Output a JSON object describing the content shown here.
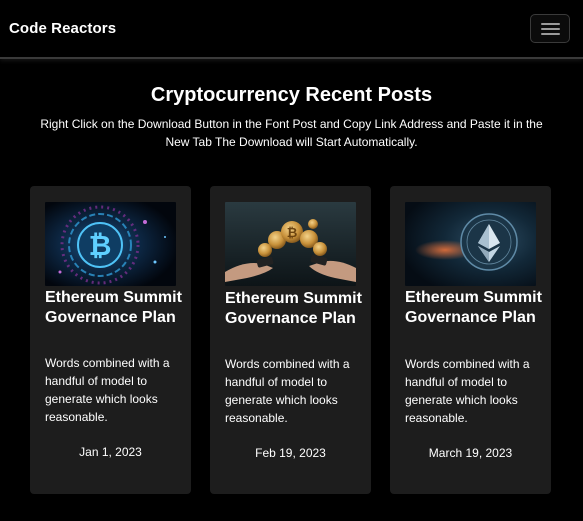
{
  "navbar": {
    "brand": "Code Reactors",
    "toggle_icon": "hamburger-menu-icon"
  },
  "hero": {
    "title": "Cryptocurrency Recent Posts",
    "subtitle": "Right Click on the Download Button in the Font Post and Copy Link Address and Paste it in the New Tab The Download will Start Automatically."
  },
  "posts": [
    {
      "image": "bitcoin-digital-image",
      "title": "Ethereum Summit Governance Plan",
      "text": "Words combined with a handful of model to generate which looks reasonable.",
      "date": "Jan 1, 2023"
    },
    {
      "image": "bitcoin-coins-hands-image",
      "title": "Ethereum Summit Governance Plan",
      "text": "Words combined with a handful of model to generate which looks reasonable.",
      "date": "Feb 19, 2023"
    },
    {
      "image": "ethereum-logo-image",
      "title": "Ethereum Summit Governance Plan",
      "text": "Words combined with a handful of model to generate which looks reasonable.",
      "date": "March 19, 2023"
    }
  ],
  "colors": {
    "background": "#000000",
    "card": "#1d1d1d",
    "text": "#ffffff",
    "border": "#3a3a3a"
  }
}
